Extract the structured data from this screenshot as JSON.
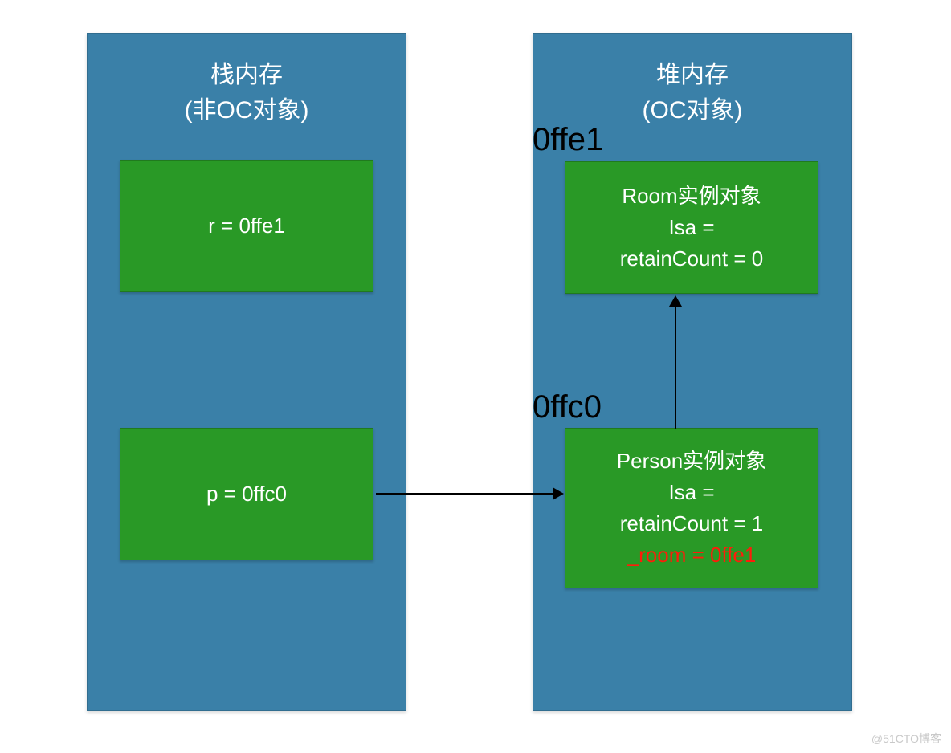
{
  "stack": {
    "title": "栈内存\n(非OC对象)",
    "r": "r = 0ffe1",
    "p": "p = 0ffc0"
  },
  "heap": {
    "title": "堆内存\n(OC对象)",
    "addr_room": "0ffe1",
    "addr_person": "0ffc0",
    "room": {
      "title": "Room实例对象",
      "isa": "Isa =",
      "retain": "retainCount = 0"
    },
    "person": {
      "title": "Person实例对象",
      "isa": "Isa =",
      "retain": "retainCount = 1",
      "room_ptr": "_room = 0ffe1"
    }
  },
  "watermark": "@51CTO博客"
}
